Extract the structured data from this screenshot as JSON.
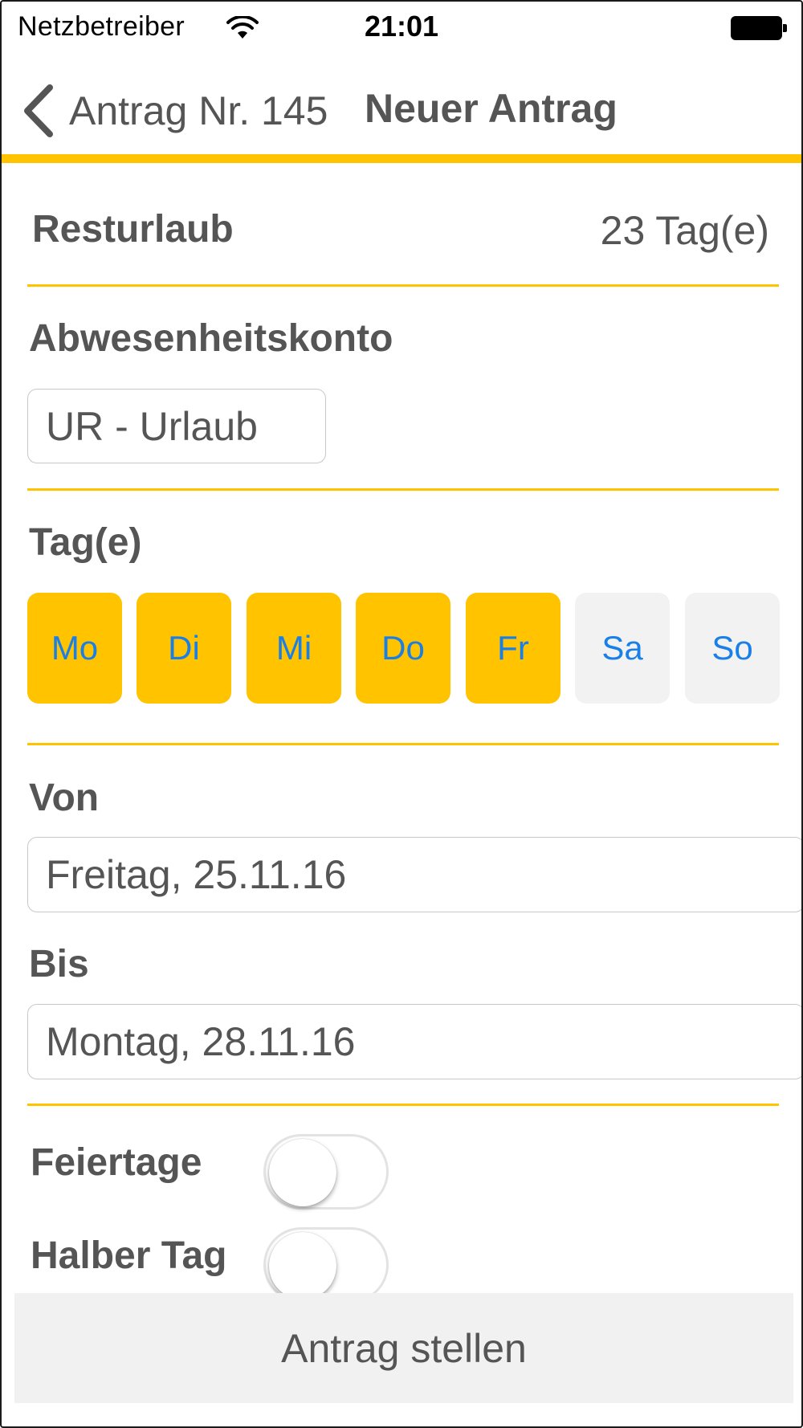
{
  "status_bar": {
    "carrier": "Netzbetreiber",
    "time": "21:01",
    "wifi_icon": "wifi-icon",
    "battery_icon": "battery-full-icon"
  },
  "nav": {
    "back_label": "Antrag Nr. 145",
    "back_icon": "chevron-left-icon",
    "title": "Neuer Antrag",
    "accent_color": "#FFC300"
  },
  "resturlaub": {
    "label": "Resturlaub",
    "value": "23 Tag(e)"
  },
  "abwesenheitskonto": {
    "label": "Abwesenheitskonto",
    "selected": "UR - Urlaub"
  },
  "tage": {
    "label": "Tag(e)",
    "days": [
      {
        "label": "Mo",
        "selected": true
      },
      {
        "label": "Di",
        "selected": true
      },
      {
        "label": "Mi",
        "selected": true
      },
      {
        "label": "Do",
        "selected": true
      },
      {
        "label": "Fr",
        "selected": true
      },
      {
        "label": "Sa",
        "selected": false
      },
      {
        "label": "So",
        "selected": false
      }
    ],
    "selected_color": "#FFC300",
    "unselected_color": "#F2F2F2",
    "text_color": "#1A7FE6"
  },
  "von": {
    "label": "Von",
    "value": "Freitag, 25.11.16"
  },
  "bis": {
    "label": "Bis",
    "value": "Montag, 28.11.16"
  },
  "feiertage": {
    "label": "Feiertage",
    "on": false
  },
  "halber_tag": {
    "label": "Halber Tag",
    "on": false
  },
  "footer": {
    "submit_label": "Antrag stellen"
  }
}
